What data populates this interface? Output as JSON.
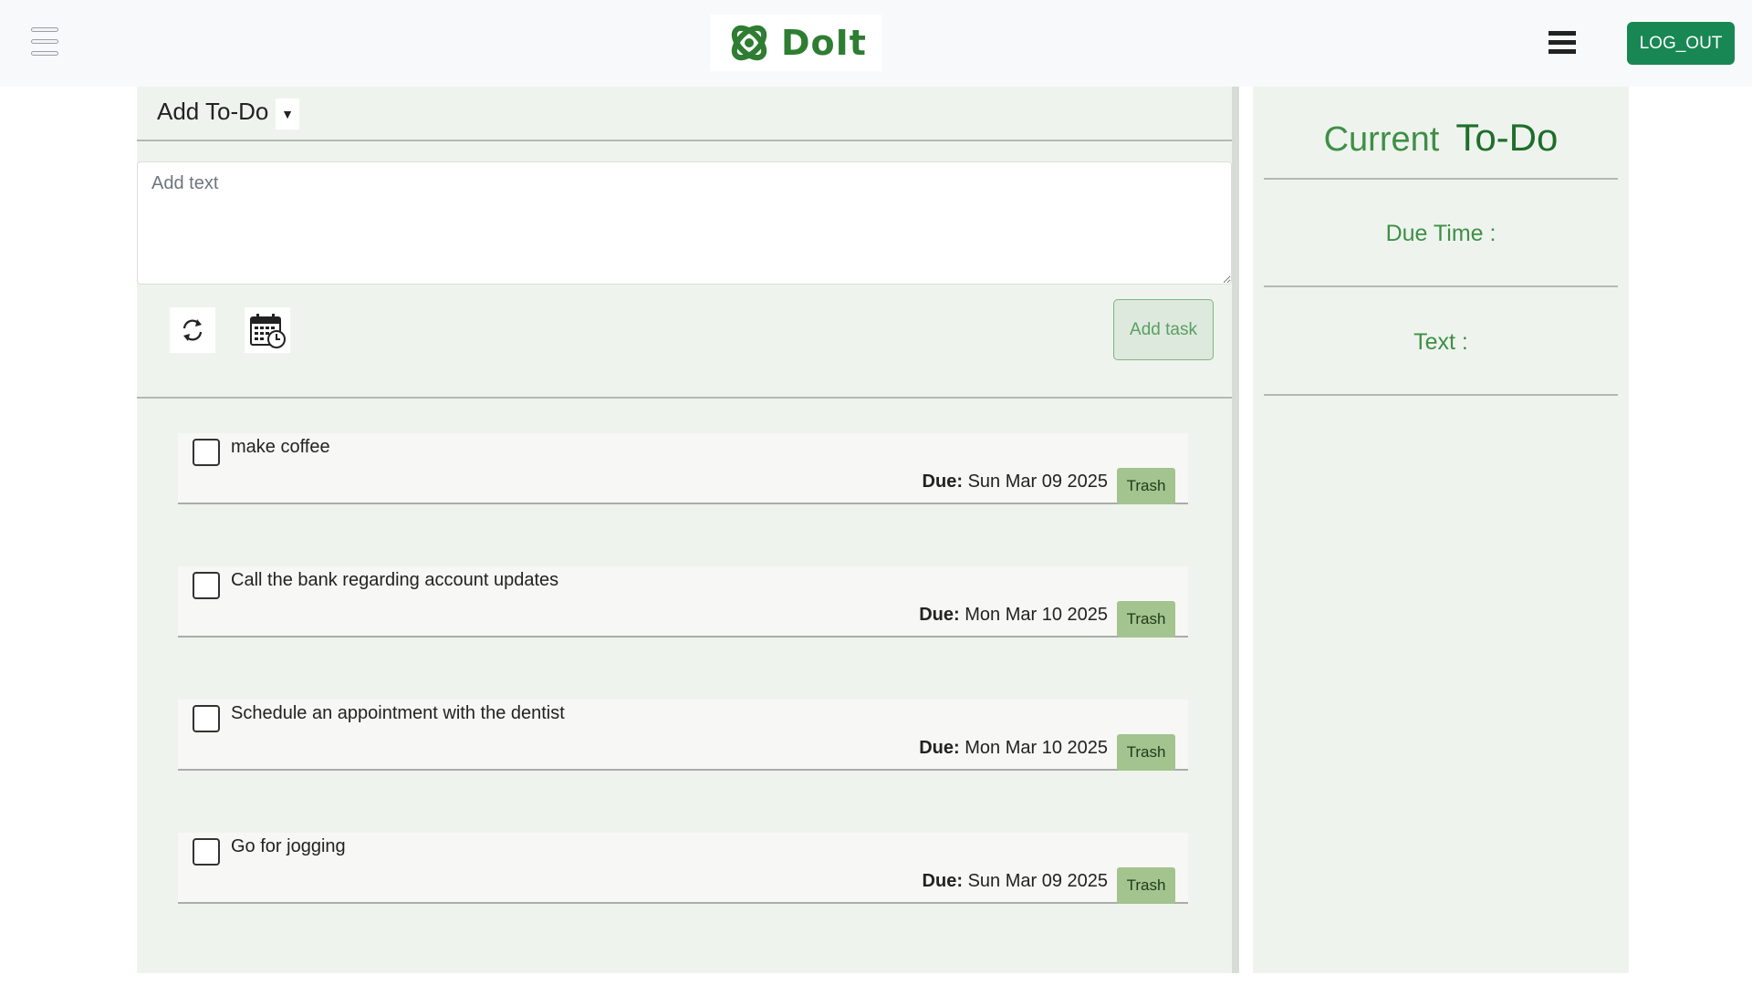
{
  "navbar": {
    "logo_text": "DoIt",
    "logout_label": "LOG_OUT",
    "menu_icon": "menu-toggle-icon",
    "hamburger_icon": "hamburger-icon",
    "brand_color": "#2e7d32",
    "logout_color": "#198754"
  },
  "add_panel": {
    "title": "Add To-Do",
    "dropdown_symbol": "▼",
    "text_placeholder": "Add text",
    "text_value": "",
    "repeat_icon": "repeat-icon",
    "calendar_icon": "calendar-clock-icon",
    "add_task_label": "Add task"
  },
  "tasks": [
    {
      "text": "make coffee",
      "due_label": "Due:",
      "due": "Sun Mar 09 2025",
      "trash_label": "Trash",
      "checked": false
    },
    {
      "text": "Call the bank regarding account updates",
      "due_label": "Due:",
      "due": "Mon Mar 10 2025",
      "trash_label": "Trash",
      "checked": false
    },
    {
      "text": "Schedule an appointment with the dentist",
      "due_label": "Due:",
      "due": "Mon Mar 10 2025",
      "trash_label": "Trash",
      "checked": false
    },
    {
      "text": "Go for jogging",
      "due_label": "Due:",
      "due": "Sun Mar 09 2025",
      "trash_label": "Trash",
      "checked": false
    }
  ],
  "current_panel": {
    "title_word1": "Current",
    "title_word2": "To-Do",
    "due_time_label": "Due Time :",
    "text_label": "Text :"
  },
  "colors": {
    "panel_bg": "#eef4ed",
    "accent_green": "#3f8f47",
    "trash_bg": "#a3c38f"
  }
}
